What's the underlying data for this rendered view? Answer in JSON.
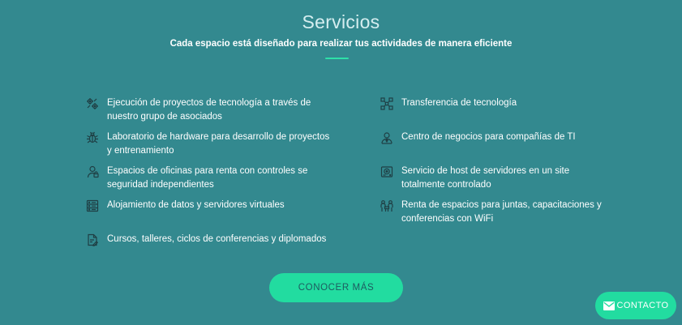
{
  "section": {
    "title": "Servicios",
    "subtitle": "Cada espacio está diseñado para realizar tus actividades de manera eficiente",
    "accent_color": "#2ee0a8",
    "background_color": "#33898f"
  },
  "services_left": [
    {
      "icon": "gears-network-icon",
      "label": "Ejecución de proyectos de tecnología a través de nuestro grupo de asociados"
    },
    {
      "icon": "bug-icon",
      "label": "Laboratorio de hardware para desarrollo de proyectos y entrenamiento"
    },
    {
      "icon": "lock-person-icon",
      "label": "Espacios de oficinas para renta con controles se seguridad independientes"
    },
    {
      "icon": "server-rack-icon",
      "label": "Alojamiento de datos y servidores virtuales"
    },
    {
      "icon": "document-edit-icon",
      "label": "Cursos, talleres, ciclos de conferencias y diplomados"
    }
  ],
  "services_right": [
    {
      "icon": "transfer-network-icon",
      "label": "Transferencia de tecnología"
    },
    {
      "icon": "business-person-icon",
      "label": "Centro de negocios para compañías de TI"
    },
    {
      "icon": "hard-drive-icon",
      "label": "Servicio de host de servidores en un site totalmente controlado"
    },
    {
      "icon": "meeting-people-icon",
      "label": "Renta de espacios para juntas, capacitaciones y conferencias con WiFi"
    }
  ],
  "cta": {
    "label": "CONOCER MÁS"
  },
  "contact": {
    "label": "CONTACTO",
    "icon": "envelope-icon"
  }
}
